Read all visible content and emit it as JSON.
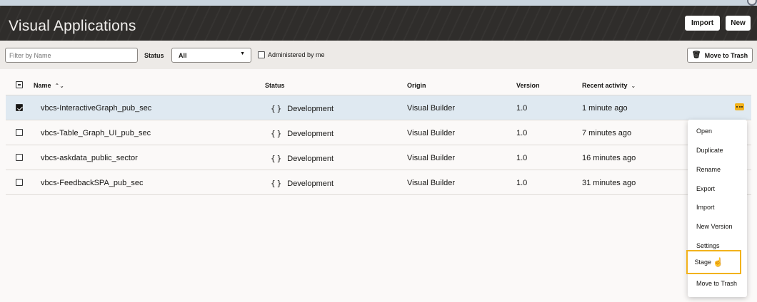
{
  "header": {
    "title": "Visual Applications",
    "import_label": "Import",
    "new_label": "New"
  },
  "toolbar": {
    "filter_placeholder": "Filter by Name",
    "status_label": "Status",
    "status_value": "All",
    "administered_label": "Administered by me",
    "trash_label": "Move to Trash"
  },
  "table": {
    "headers": {
      "name": "Name",
      "status": "Status",
      "origin": "Origin",
      "version": "Version",
      "activity": "Recent activity"
    },
    "rows": [
      {
        "name": "vbcs-InteractiveGraph_pub_sec",
        "status": "Development",
        "origin": "Visual Builder",
        "version": "1.0",
        "activity": "1 minute ago",
        "checked": true
      },
      {
        "name": "vbcs-Table_Graph_UI_pub_sec",
        "status": "Development",
        "origin": "Visual Builder",
        "version": "1.0",
        "activity": "7 minutes ago",
        "checked": false
      },
      {
        "name": "vbcs-askdata_public_sector",
        "status": "Development",
        "origin": "Visual Builder",
        "version": "1.0",
        "activity": "16 minutes ago",
        "checked": false
      },
      {
        "name": "vbcs-FeedbackSPA_pub_sec",
        "status": "Development",
        "origin": "Visual Builder",
        "version": "1.0",
        "activity": "31 minutes ago",
        "checked": false
      }
    ]
  },
  "context_menu": {
    "items": [
      "Open",
      "Duplicate",
      "Rename",
      "Export",
      "Import",
      "New Version",
      "Settings",
      "Stage",
      "Move to Trash"
    ],
    "highlighted": "Stage"
  },
  "colors": {
    "accent": "#f2b21b",
    "header_bg": "#2f2d2b",
    "selected_row": "#dfe9f1"
  }
}
